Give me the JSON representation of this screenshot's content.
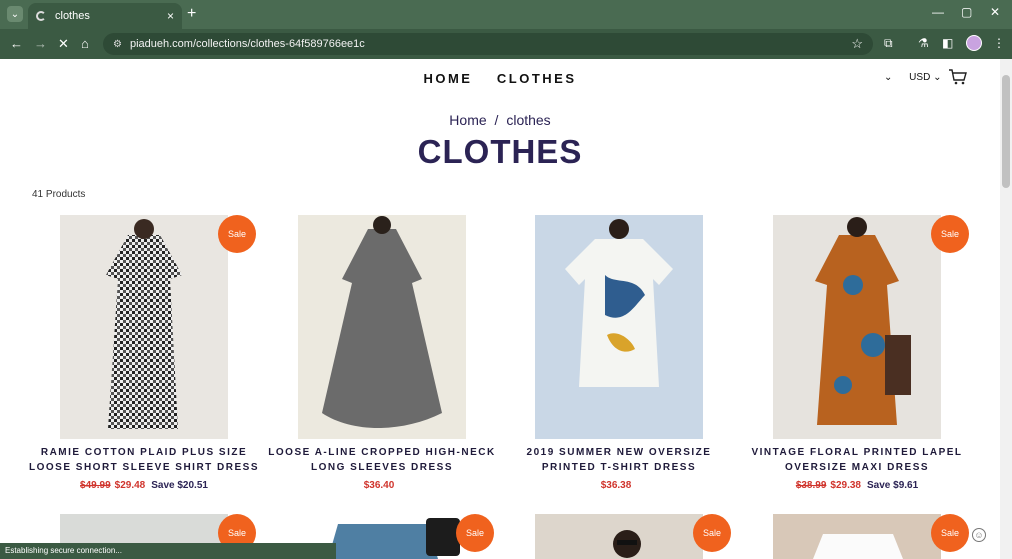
{
  "browser": {
    "tab_title": "clothes",
    "tab_close": "×",
    "new_tab": "+",
    "url": "piadueh.com/collections/clothes-64f589766ee1c",
    "minimize": "—",
    "maximize": "▢",
    "close": "✕",
    "status": "Establishing secure connection..."
  },
  "header": {
    "nav": [
      "HOME",
      "CLOTHES"
    ],
    "currency": "USD"
  },
  "breadcrumb": {
    "home": "Home",
    "sep": "/",
    "current": "clothes"
  },
  "title": "CLOTHES",
  "count": "41 Products",
  "sale_label": "Sale",
  "products": [
    {
      "name1": "RAMIE COTTON PLAID PLUS SIZE",
      "name2": "LOOSE SHORT SLEEVE SHIRT DRESS",
      "old": "$49.99",
      "price": "$29.48",
      "save": "Save $20.51",
      "sale": true
    },
    {
      "name1": "LOOSE A-LINE CROPPED HIGH-NECK",
      "name2": "LONG SLEEVES DRESS",
      "old": "",
      "price": "$36.40",
      "save": "",
      "sale": false
    },
    {
      "name1": "2019 SUMMER NEW OVERSIZE",
      "name2": "PRINTED T-SHIRT DRESS",
      "old": "",
      "price": "$36.38",
      "save": "",
      "sale": false
    },
    {
      "name1": "VINTAGE FLORAL PRINTED LAPEL",
      "name2": "OVERSIZE MAXI DRESS",
      "old": "$38.99",
      "price": "$29.38",
      "save": "Save $9.61",
      "sale": true
    }
  ]
}
